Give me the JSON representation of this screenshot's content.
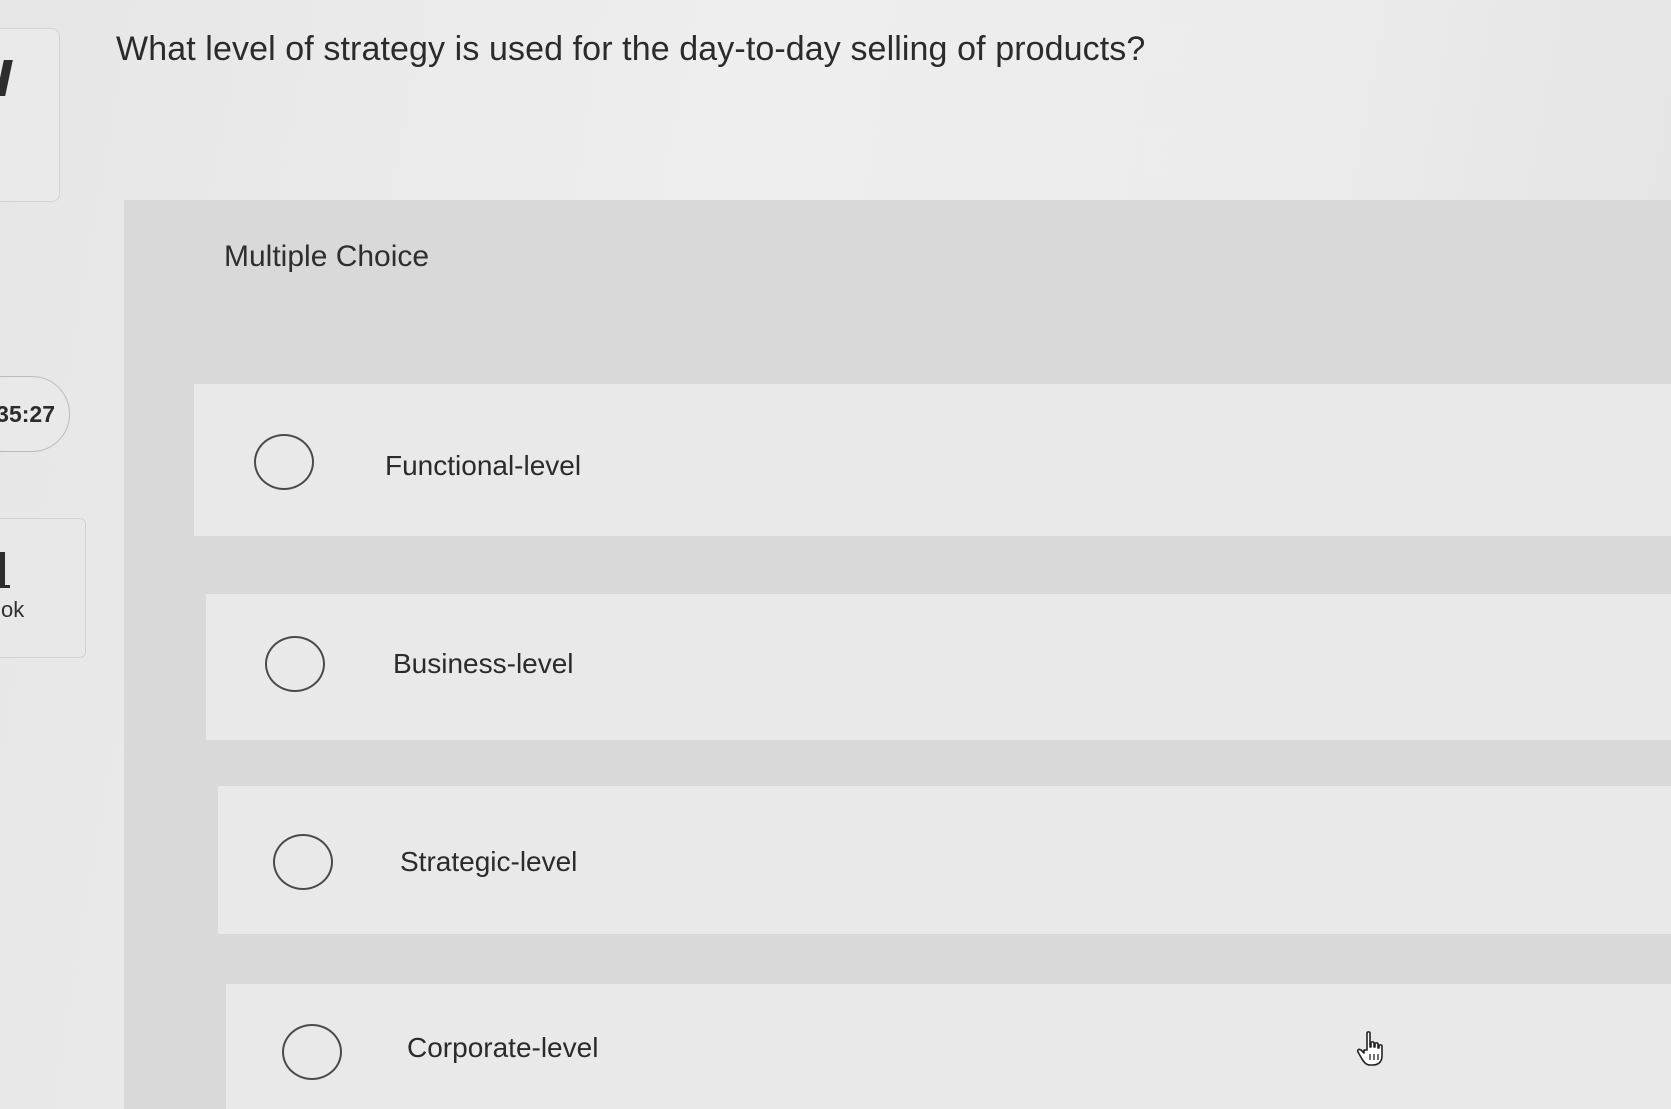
{
  "sidebar": {
    "timer": "35:27",
    "book_label": "ok"
  },
  "question": {
    "text": "What level of strategy is used for the day-to-day selling of products?",
    "type_label": "Multiple Choice",
    "options": [
      {
        "label": "Functional-level",
        "selected": false
      },
      {
        "label": "Business-level",
        "selected": false
      },
      {
        "label": "Strategic-level",
        "selected": false
      },
      {
        "label": "Corporate-level",
        "selected": false
      }
    ]
  },
  "icons": {
    "cursor": "hand-pointer-icon",
    "radio": "radio-circle-icon"
  },
  "colors": {
    "background": "#ececec",
    "panel": "#d9d9d9",
    "option_row": "#e9e9e9",
    "text": "#2b2b2b"
  }
}
